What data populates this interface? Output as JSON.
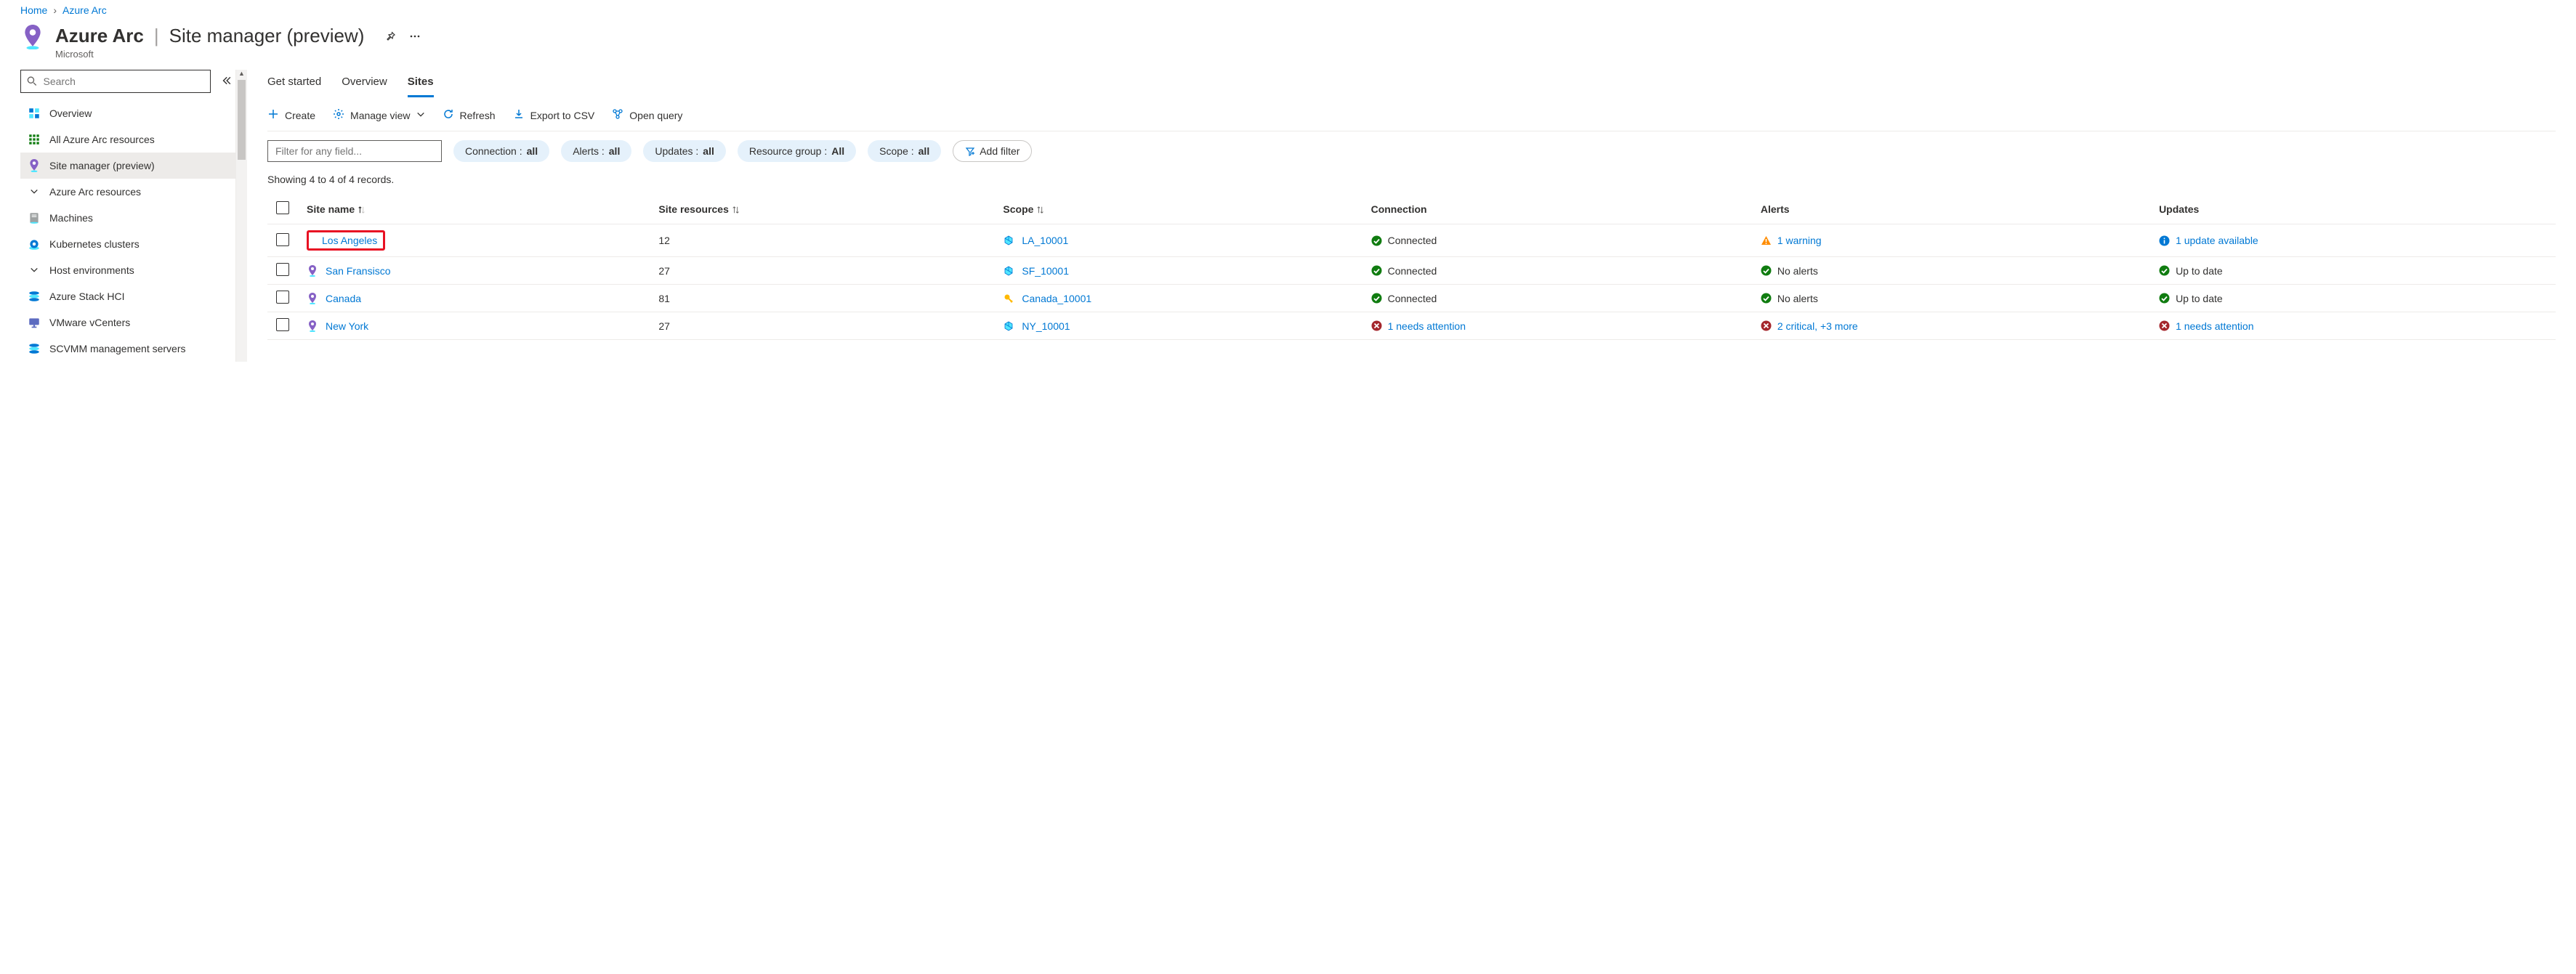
{
  "breadcrumb": {
    "home": "Home",
    "parent": "Azure Arc"
  },
  "header": {
    "title": "Azure Arc",
    "page_title": "Site manager (preview)",
    "publisher": "Microsoft"
  },
  "sidebar": {
    "search_placeholder": "Search",
    "items": [
      {
        "label": "Overview",
        "type": "item"
      },
      {
        "label": "All Azure Arc resources",
        "type": "item"
      },
      {
        "label": "Site manager (preview)",
        "type": "item",
        "selected": true
      },
      {
        "label": "Azure Arc resources",
        "type": "group"
      },
      {
        "label": "Machines",
        "type": "item"
      },
      {
        "label": "Kubernetes clusters",
        "type": "item"
      },
      {
        "label": "Host environments",
        "type": "group"
      },
      {
        "label": "Azure Stack HCI",
        "type": "item"
      },
      {
        "label": "VMware vCenters",
        "type": "item"
      },
      {
        "label": "SCVMM management servers",
        "type": "item"
      }
    ]
  },
  "tabs": [
    {
      "label": "Get started",
      "active": false
    },
    {
      "label": "Overview",
      "active": false
    },
    {
      "label": "Sites",
      "active": true
    }
  ],
  "toolbar": {
    "create": "Create",
    "manage_view": "Manage view",
    "refresh": "Refresh",
    "export_csv": "Export to CSV",
    "open_query": "Open query"
  },
  "filters": {
    "input_placeholder": "Filter for any field...",
    "pills": [
      {
        "label": "Connection : ",
        "value": "all"
      },
      {
        "label": "Alerts : ",
        "value": "all"
      },
      {
        "label": "Updates : ",
        "value": "all"
      },
      {
        "label": "Resource group : ",
        "value": "All"
      },
      {
        "label": "Scope : ",
        "value": "all"
      }
    ],
    "add_filter": "Add filter"
  },
  "records_text": "Showing 4 to 4 of 4 records.",
  "table": {
    "columns": {
      "site_name": "Site name",
      "site_resources": "Site resources",
      "scope": "Scope",
      "connection": "Connection",
      "alerts": "Alerts",
      "updates": "Updates"
    },
    "rows": [
      {
        "site_name": "Los Angeles",
        "highlighted": true,
        "site_resources": "12",
        "scope": "LA_10001",
        "scope_icon": "resource-group",
        "connection": {
          "status": "ok",
          "text": "Connected",
          "link": false
        },
        "alerts": {
          "status": "warning",
          "text": "1 warning",
          "link": true
        },
        "updates": {
          "status": "info",
          "text": "1 update available",
          "link": true
        }
      },
      {
        "site_name": "San Fransisco",
        "highlighted": false,
        "site_resources": "27",
        "scope": "SF_10001",
        "scope_icon": "resource-group",
        "connection": {
          "status": "ok",
          "text": "Connected",
          "link": false
        },
        "alerts": {
          "status": "ok",
          "text": "No alerts",
          "link": false
        },
        "updates": {
          "status": "ok",
          "text": "Up to date",
          "link": false
        }
      },
      {
        "site_name": "Canada",
        "highlighted": false,
        "site_resources": "81",
        "scope": "Canada_10001",
        "scope_icon": "subscription",
        "connection": {
          "status": "ok",
          "text": "Connected",
          "link": false
        },
        "alerts": {
          "status": "ok",
          "text": "No alerts",
          "link": false
        },
        "updates": {
          "status": "ok",
          "text": "Up to date",
          "link": false
        }
      },
      {
        "site_name": "New York",
        "highlighted": false,
        "site_resources": "27",
        "scope": "NY_10001",
        "scope_icon": "resource-group",
        "connection": {
          "status": "error",
          "text": "1 needs attention",
          "link": true
        },
        "alerts": {
          "status": "error",
          "text": "2 critical, +3 more",
          "link": true
        },
        "updates": {
          "status": "error",
          "text": "1 needs attention",
          "link": true
        }
      }
    ]
  }
}
